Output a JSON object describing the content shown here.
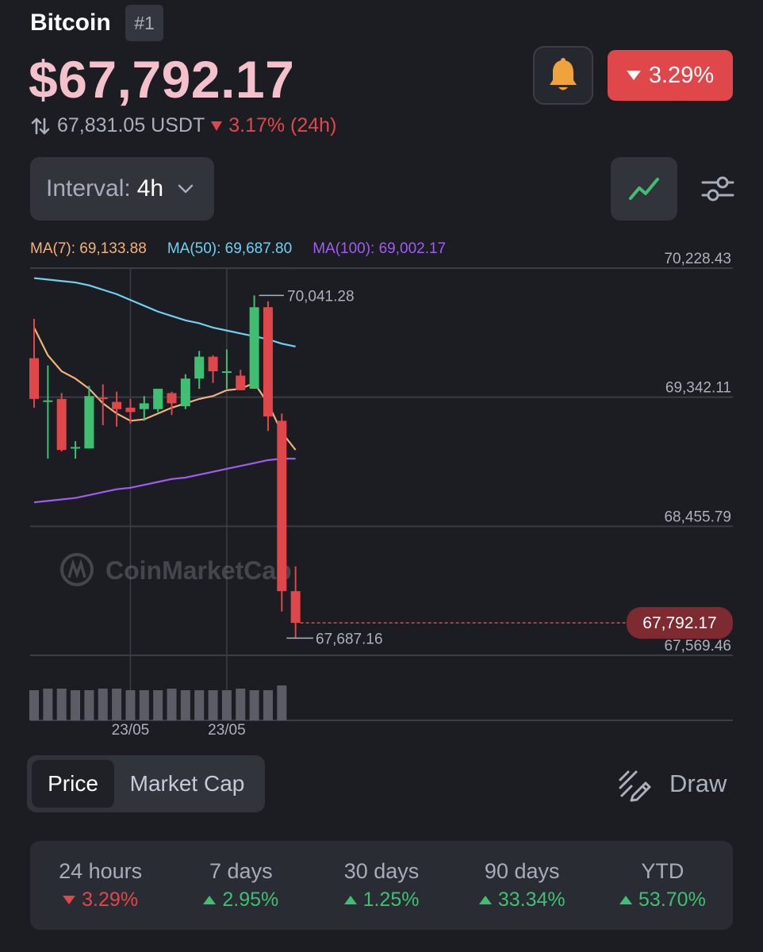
{
  "header": {
    "coin_name": "Bitcoin",
    "rank": "#1",
    "price": "$67,792.17",
    "usdt_price": "67,831.05 USDT",
    "change_24h": "3.17% (24h)",
    "change_badge": "3.29%",
    "colors": {
      "down": "#e0474a",
      "up": "#3fbf72",
      "price": "#f4c0cc"
    }
  },
  "controls": {
    "interval_label": "Interval:",
    "interval_value": "4h",
    "bell_icon": "bell-icon",
    "line_chart_icon": "line-chart-icon",
    "settings_icon": "sliders-icon"
  },
  "ma_legend": {
    "ma7": "MA(7): 69,133.88",
    "ma50": "MA(50): 69,687.80",
    "ma100": "MA(100): 69,002.17"
  },
  "chart_data": {
    "type": "candlestick",
    "title": "",
    "y_ticks": [
      "70,228.43",
      "69,342.11",
      "68,455.79",
      "67,569.46"
    ],
    "y_tick_values": [
      70228.43,
      69342.11,
      68455.79,
      67569.46
    ],
    "ylim": [
      67569.46,
      70228.43
    ],
    "x_labels": [
      "23/05",
      "23/05"
    ],
    "x_label_candle_index": [
      7,
      14
    ],
    "high_label": "70,041.28",
    "high_value": 70041.28,
    "high_candle_index": 16,
    "low_label": "67,687.16",
    "low_value": 67687.16,
    "low_candle_index": 18,
    "current_price_label": "67,792.17",
    "current_price": 67792.17,
    "watermark": "CoinMarketCap",
    "colors": {
      "up": "#3fbf72",
      "down": "#e0474a",
      "ma7": "#f0b27a",
      "ma50": "#6fd0f0",
      "ma100": "#a05cf0"
    },
    "candles": [
      {
        "o": 69610,
        "h": 69880,
        "l": 69270,
        "c": 69330
      },
      {
        "o": 69310,
        "h": 69560,
        "l": 68920,
        "c": 69320
      },
      {
        "o": 69330,
        "h": 69370,
        "l": 68970,
        "c": 68980
      },
      {
        "o": 68990,
        "h": 69040,
        "l": 68920,
        "c": 69000
      },
      {
        "o": 68990,
        "h": 69420,
        "l": 68990,
        "c": 69350
      },
      {
        "o": 69340,
        "h": 69430,
        "l": 69150,
        "c": 69330
      },
      {
        "o": 69310,
        "h": 69380,
        "l": 69140,
        "c": 69260
      },
      {
        "o": 69270,
        "h": 69330,
        "l": 69160,
        "c": 69240
      },
      {
        "o": 69260,
        "h": 69350,
        "l": 69180,
        "c": 69300
      },
      {
        "o": 69260,
        "h": 69400,
        "l": 69240,
        "c": 69400
      },
      {
        "o": 69370,
        "h": 69380,
        "l": 69220,
        "c": 69300
      },
      {
        "o": 69280,
        "h": 69500,
        "l": 69260,
        "c": 69470
      },
      {
        "o": 69470,
        "h": 69660,
        "l": 69400,
        "c": 69620
      },
      {
        "o": 69620,
        "h": 69630,
        "l": 69440,
        "c": 69520
      },
      {
        "o": 69510,
        "h": 69670,
        "l": 69400,
        "c": 69520
      },
      {
        "o": 69490,
        "h": 69530,
        "l": 69400,
        "c": 69390
      },
      {
        "o": 69400,
        "h": 70041,
        "l": 69400,
        "c": 69960
      },
      {
        "o": 69960,
        "h": 70000,
        "l": 69110,
        "c": 69210
      },
      {
        "o": 69180,
        "h": 69230,
        "l": 67870,
        "c": 68010
      },
      {
        "o": 68010,
        "h": 68180,
        "l": 67687,
        "c": 67792
      }
    ],
    "ma7": [
      69820,
      69630,
      69520,
      69470,
      69400,
      69300,
      69230,
      69180,
      69190,
      69230,
      69270,
      69300,
      69330,
      69350,
      69390,
      69400,
      69440,
      69300,
      69100,
      68980
    ],
    "ma50": [
      70160,
      70150,
      70140,
      70130,
      70110,
      70080,
      70050,
      70010,
      69970,
      69930,
      69900,
      69870,
      69850,
      69820,
      69800,
      69780,
      69760,
      69740,
      69710,
      69690
    ],
    "ma100": [
      68620,
      68630,
      68640,
      68650,
      68670,
      68690,
      68710,
      68720,
      68740,
      68760,
      68780,
      68790,
      68810,
      68830,
      68850,
      68870,
      68890,
      68910,
      68920,
      68920
    ],
    "volume": [
      38,
      40,
      40,
      38,
      38,
      40,
      40,
      38,
      38,
      38,
      40,
      38,
      38,
      38,
      38,
      40,
      38,
      38,
      44,
      0
    ]
  },
  "tabs": {
    "price_label": "Price",
    "market_cap_label": "Market Cap",
    "draw_label": "Draw"
  },
  "performance": [
    {
      "label": "24 hours",
      "value": "3.29%",
      "direction": "down"
    },
    {
      "label": "7 days",
      "value": "2.95%",
      "direction": "up"
    },
    {
      "label": "30 days",
      "value": "1.25%",
      "direction": "up"
    },
    {
      "label": "90 days",
      "value": "33.34%",
      "direction": "up"
    },
    {
      "label": "YTD",
      "value": "53.70%",
      "direction": "up"
    }
  ]
}
